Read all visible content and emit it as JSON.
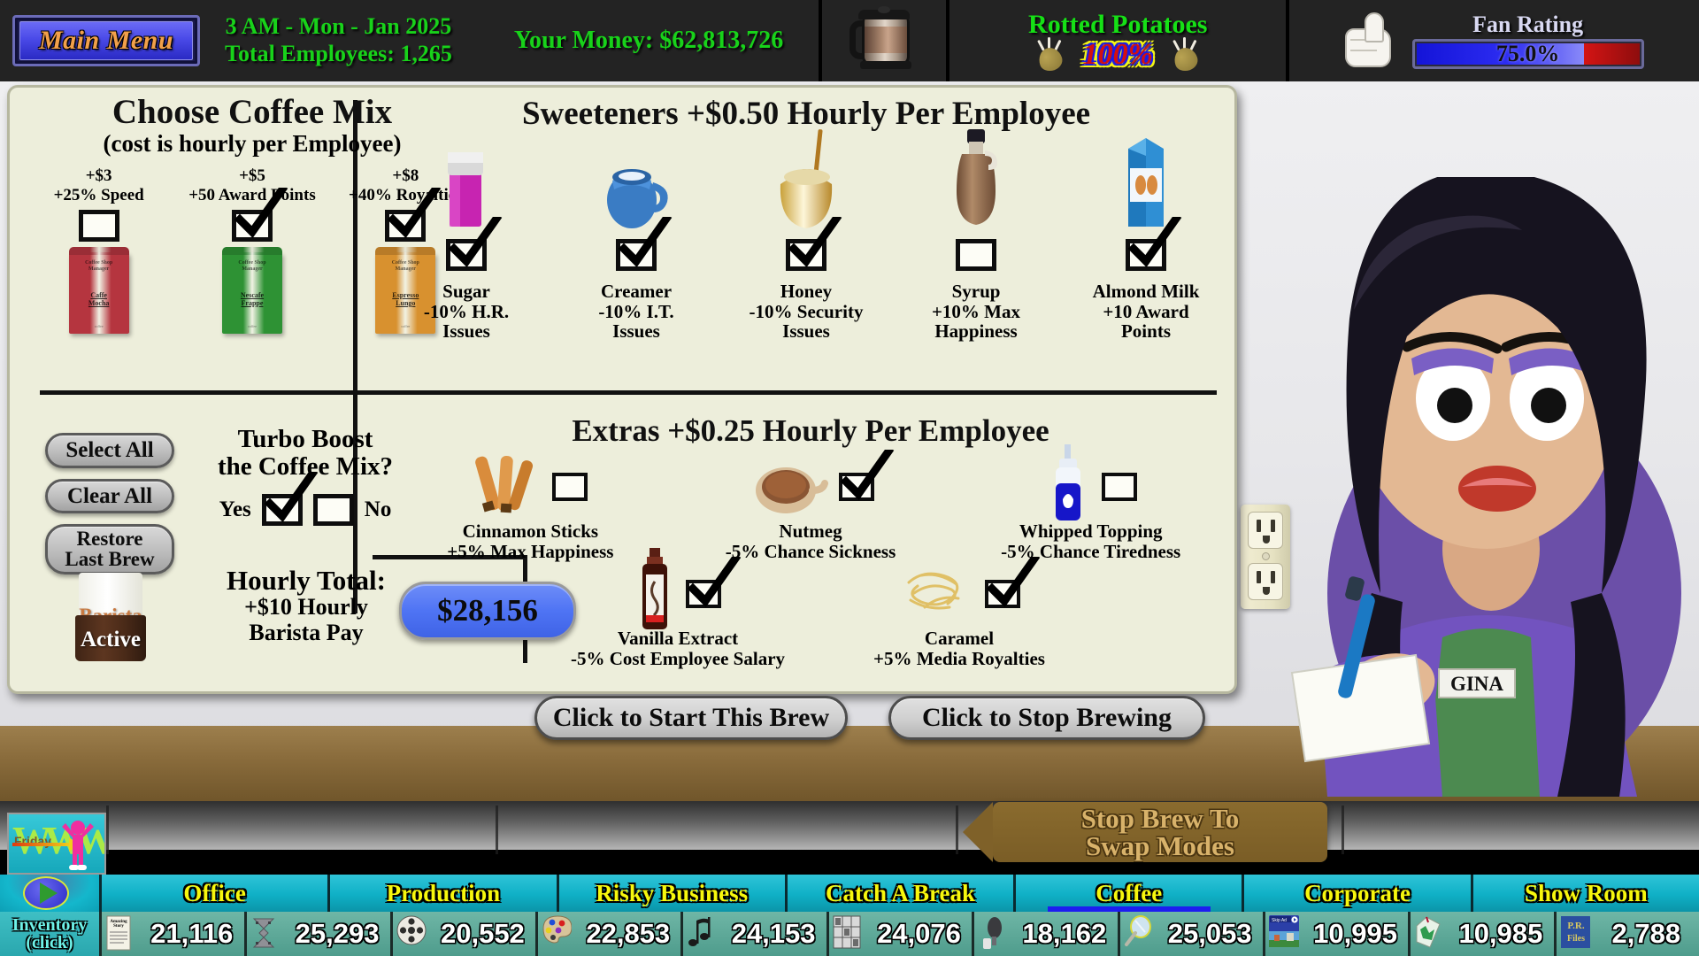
{
  "topbar": {
    "main_menu_label": "Main Menu",
    "clock": "3 AM - Mon - Jan 2025",
    "employees": "Total Employees: 1,265",
    "money": "Your Money: $62,813,726",
    "rotted_title": "Rotted Potatoes",
    "rotted_pct": "100%",
    "fan_title": "Fan Rating",
    "fan_value": "75.0%",
    "fan_percent": 75,
    "colors": {
      "green": "#18d21a",
      "bar_blue": "#2d2df2",
      "bar_red": "#d41414",
      "menu_orange": "#f2a04a"
    }
  },
  "coffee_mix": {
    "title": "Choose Coffee Mix",
    "subtitle": "(cost is hourly per Employee)",
    "options": [
      {
        "cost": "+$3",
        "bonus": "+25% Speed",
        "bag_name": "Caffe Mocha",
        "bag_brand": "Coffee Shop Manager",
        "color": "#b5353f",
        "checked": false
      },
      {
        "cost": "+$5",
        "bonus": "+50 Award Points",
        "bag_name": "Nescafe Frappe",
        "bag_brand": "Coffee Shop Manager",
        "color": "#2e9234",
        "checked": true
      },
      {
        "cost": "+$8",
        "bonus": "+40% Royalties",
        "bag_name": "Espresso Lungo",
        "bag_brand": "Coffee Shop Manager",
        "color": "#d8912f",
        "checked": true
      }
    ]
  },
  "sweeteners": {
    "title": "Sweeteners +$0.50 Hourly Per Employee",
    "items": [
      {
        "icon": "sugar-packet-icon",
        "name": "Sugar",
        "effect": "-10% H.R.\nIssues",
        "checked": true
      },
      {
        "icon": "creamer-jug-icon",
        "name": "Creamer",
        "effect": "-10% I.T.\nIssues",
        "checked": true
      },
      {
        "icon": "honey-pot-icon",
        "name": "Honey",
        "effect": "-10% Security\nIssues",
        "checked": true
      },
      {
        "icon": "syrup-bottle-icon",
        "name": "Syrup",
        "effect": "+10% Max\nHappiness",
        "checked": false
      },
      {
        "icon": "almond-milk-icon",
        "name": "Almond Milk",
        "effect": "+10 Award\nPoints",
        "checked": true
      }
    ]
  },
  "extras": {
    "title": "Extras +$0.25 Hourly Per Employee",
    "items": [
      {
        "icon": "cinnamon-sticks-icon",
        "name": "Cinnamon Sticks",
        "effect": "+5% Max Happiness",
        "checked": false
      },
      {
        "icon": "nutmeg-scoop-icon",
        "name": "Nutmeg",
        "effect": "-5% Chance Sickness",
        "checked": true
      },
      {
        "icon": "whipped-topping-icon",
        "name": "Whipped Topping",
        "effect": "-5% Chance Tiredness",
        "checked": false
      },
      {
        "icon": "vanilla-extract-icon",
        "name": "Vanilla Extract",
        "effect": "-5% Cost Employee Salary",
        "checked": true
      },
      {
        "icon": "caramel-drizzle-icon",
        "name": "Caramel",
        "effect": "+5% Media Royalties",
        "checked": true
      }
    ]
  },
  "left_controls": {
    "select_all": "Select All",
    "clear_all": "Clear All",
    "restore_line1": "Restore",
    "restore_line2": "Last Brew",
    "barista_line1": "Barista",
    "barista_line2": "Active"
  },
  "turbo": {
    "title_line1": "Turbo Boost",
    "title_line2": "the Coffee Mix?",
    "yes_label": "Yes",
    "no_label": "No",
    "yes_checked": true,
    "no_checked": false
  },
  "hourly": {
    "title": "Hourly Total:",
    "line2": "+$10 Hourly",
    "line3": "Barista Pay",
    "total": "$28,156"
  },
  "actions": {
    "start": "Click to Start This Brew",
    "stop": "Click to Stop Brewing",
    "swap_line1": "Stop Brew To",
    "swap_line2": "Swap Modes"
  },
  "character": {
    "name_tag": "GINA"
  },
  "navbar": {
    "inventory_line1": "Inventory",
    "inventory_line2": "(click)",
    "friday_label": "Friday",
    "tabs": [
      {
        "label": "Office",
        "active": false
      },
      {
        "label": "Production",
        "active": false
      },
      {
        "label": "Risky Business",
        "active": false
      },
      {
        "label": "Catch A Break",
        "active": false
      },
      {
        "label": "Coffee",
        "active": true
      },
      {
        "label": "Corporate",
        "active": false
      },
      {
        "label": "Show Room",
        "active": false
      }
    ]
  },
  "inventory": [
    {
      "icon": "script-page-icon",
      "value": "21,116"
    },
    {
      "icon": "film-strip-icon",
      "value": "25,293"
    },
    {
      "icon": "film-reel-icon",
      "value": "20,552"
    },
    {
      "icon": "paint-palette-icon",
      "value": "22,853"
    },
    {
      "icon": "music-note-icon",
      "value": "24,153"
    },
    {
      "icon": "storyboard-icon",
      "value": "24,076"
    },
    {
      "icon": "microphone-icon",
      "value": "18,162"
    },
    {
      "icon": "lens-icon",
      "value": "25,053"
    },
    {
      "icon": "ad-screen-icon",
      "value": "10,995"
    },
    {
      "icon": "money-tag-icon",
      "value": "10,985"
    },
    {
      "icon": "pr-files-icon",
      "value": "2,788"
    }
  ]
}
